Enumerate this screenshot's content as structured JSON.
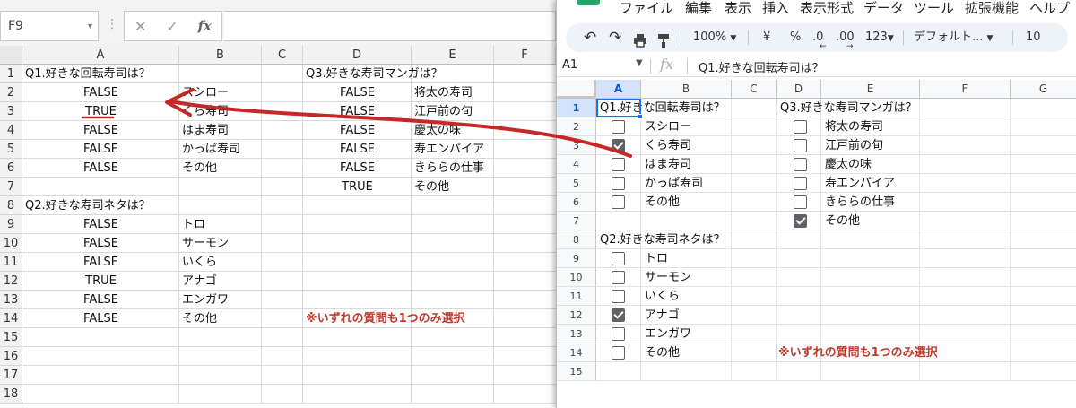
{
  "excel": {
    "name_box": "F9",
    "formula_icons": [
      "✕",
      "✓",
      "fx"
    ],
    "columns": [
      "A",
      "B",
      "C",
      "D",
      "E",
      "F"
    ],
    "rows": [
      "1",
      "2",
      "3",
      "4",
      "5",
      "6",
      "7",
      "8",
      "9",
      "10",
      "11",
      "12",
      "13",
      "14",
      "15",
      "16",
      "17",
      "18"
    ],
    "cells": {
      "a1": "Q1.好きな回転寿司は？",
      "a2": "FALSE",
      "b2": "スシロー",
      "a3": "TRUE",
      "b3": "くら寿司",
      "a4": "FALSE",
      "b4": "はま寿司",
      "a5": "FALSE",
      "b5": "かっぱ寿司",
      "a6": "FALSE",
      "b6": "その他",
      "a8": "Q2.好きな寿司ネタは？",
      "a9": "FALSE",
      "b9": "トロ",
      "a10": "FALSE",
      "b10": "サーモン",
      "a11": "FALSE",
      "b11": "いくら",
      "a12": "TRUE",
      "b12": "アナゴ",
      "a13": "FALSE",
      "b13": "エンガワ",
      "a14": "FALSE",
      "b14": "その他",
      "d1": "Q3.好きな寿司マンガは？",
      "d2": "FALSE",
      "e2": "将太の寿司",
      "d3": "FALSE",
      "e3": "江戸前の旬",
      "d4": "FALSE",
      "e4": "慶太の味",
      "d5": "FALSE",
      "e5": "寿エンパイア",
      "d6": "FALSE",
      "e6": "きららの仕事",
      "d7": "TRUE",
      "e7": "その他",
      "d14": "※いずれの質問も1つのみ選択"
    }
  },
  "sheets": {
    "menu": [
      "ファイル",
      "編集",
      "表示",
      "挿入",
      "表示形式",
      "データ",
      "ツール",
      "拡張機能",
      "ヘルプ"
    ],
    "toolbar": {
      "zoom": "100%",
      "currency": "¥",
      "percent": "%",
      "dec_decrease": ".0",
      "dec_increase": ".00",
      "number_format": "123",
      "font": "デフォルト...",
      "font_size": "10"
    },
    "cell_ref": "A1",
    "fx_label": "fx",
    "formula_value": "Q1.好きな回転寿司は？",
    "columns": [
      "A",
      "B",
      "C",
      "D",
      "E",
      "F",
      "G"
    ],
    "rows": [
      "1",
      "2",
      "3",
      "4",
      "5",
      "6",
      "7",
      "8",
      "9",
      "10",
      "11",
      "12",
      "13",
      "14",
      "15"
    ],
    "cells": {
      "a1": "Q1.好きな回転寿司は？",
      "b2": "スシロー",
      "b3": "くら寿司",
      "b4": "はま寿司",
      "b5": "かっぱ寿司",
      "b6": "その他",
      "a8": "Q2.好きな寿司ネタは？",
      "b9": "トロ",
      "b10": "サーモン",
      "b11": "いくら",
      "b12": "アナゴ",
      "b13": "エンガワ",
      "b14": "その他",
      "d1": "Q3.好きな寿司マンガは？",
      "e2": "将太の寿司",
      "e3": "江戸前の旬",
      "e4": "慶太の味",
      "e5": "寿エンパイア",
      "e6": "きららの仕事",
      "e7": "その他",
      "d14": "※いずれの質問も1つのみ選択"
    },
    "checkboxes": {
      "q1": [
        false,
        true,
        false,
        false,
        false
      ],
      "q2": [
        false,
        false,
        false,
        true,
        false,
        false
      ],
      "q3": [
        false,
        false,
        false,
        false,
        false,
        true
      ]
    }
  },
  "colors": {
    "annotation_red": "#c62828",
    "note_red": "#c0392b",
    "sheets_green": "#23a566",
    "selection_blue": "#1a73e8"
  }
}
